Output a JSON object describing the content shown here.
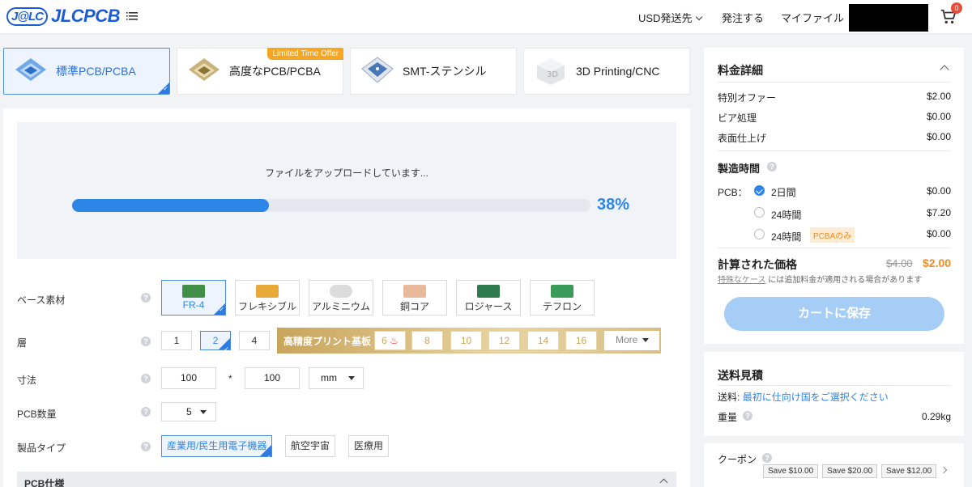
{
  "header": {
    "logo_badge": "J@LC",
    "logo_text": "JLCPCB",
    "nav_currency": "USD発送先",
    "nav_order": "発注する",
    "nav_files": "マイファイル",
    "cart_count": "0"
  },
  "product_tabs": [
    {
      "label": "標準PCB/PCBA",
      "active": true
    },
    {
      "label": "高度なPCB/PCBA",
      "ribbon": "Limited Time Offer"
    },
    {
      "label": "SMT-ステンシル"
    },
    {
      "label": "3D Printing/CNC"
    }
  ],
  "upload": {
    "status_text": "ファイルをアップロードしています...",
    "progress": 0.38,
    "percent_label": "38%"
  },
  "form": {
    "base_material_label": "ベース素材",
    "materials": [
      "FR-4",
      "フレキシブル",
      "アルミニウム",
      "銅コア",
      "ロジャース",
      "テフロン"
    ],
    "layers_label": "層",
    "layers": [
      "1",
      "2",
      "4"
    ],
    "hd_label": "高精度プリント基板",
    "hd_layers": [
      "6",
      "8",
      "10",
      "12",
      "14",
      "16"
    ],
    "more_label": "More",
    "size_label": "寸法",
    "size_w": "100",
    "size_sep": "*",
    "size_h": "100",
    "size_unit": "mm",
    "qty_label": "PCB数量",
    "qty_value": "5",
    "ptype_label": "製品タイプ",
    "ptypes": [
      "産業用/民生用電子機器",
      "航空宇宙",
      "医療用"
    ],
    "spec_label": "PCB仕様"
  },
  "pricing": {
    "title": "料金詳細",
    "rows": [
      {
        "label": "特別オファー",
        "value": "$2.00"
      },
      {
        "label": "ビア処理",
        "value": "$0.00"
      },
      {
        "label": "表面仕上げ",
        "value": "$0.00"
      }
    ],
    "build_time_label": "製造時間",
    "pcb_label": "PCB：",
    "build_options": [
      {
        "label": "2日間",
        "value": "$0.00",
        "selected": true
      },
      {
        "label": "24時間",
        "value": "$7.20"
      },
      {
        "label": "24時間",
        "tag": "PCBAのみ",
        "value": "$0.00"
      }
    ],
    "calc_label": "計算された価格",
    "old_price": "$4.00",
    "new_price": "$2.00",
    "note_link": "特殊なケース",
    "note_text": "には追加料金が適用される場合があります",
    "save_button": "カートに保存"
  },
  "shipping": {
    "title": "送料見積",
    "ship_label": "送料:",
    "ship_link": "最初に仕向け国をご選択ください",
    "weight_label": "重量",
    "weight_value": "0.29kg"
  },
  "coupons": {
    "title": "クーポン",
    "items": [
      "Save $10.00",
      "Save $20.00",
      "Save $12.00"
    ]
  },
  "colors": {
    "accent": "#2b86e8",
    "price": "#f08c20",
    "gold": "#c9a55c"
  }
}
